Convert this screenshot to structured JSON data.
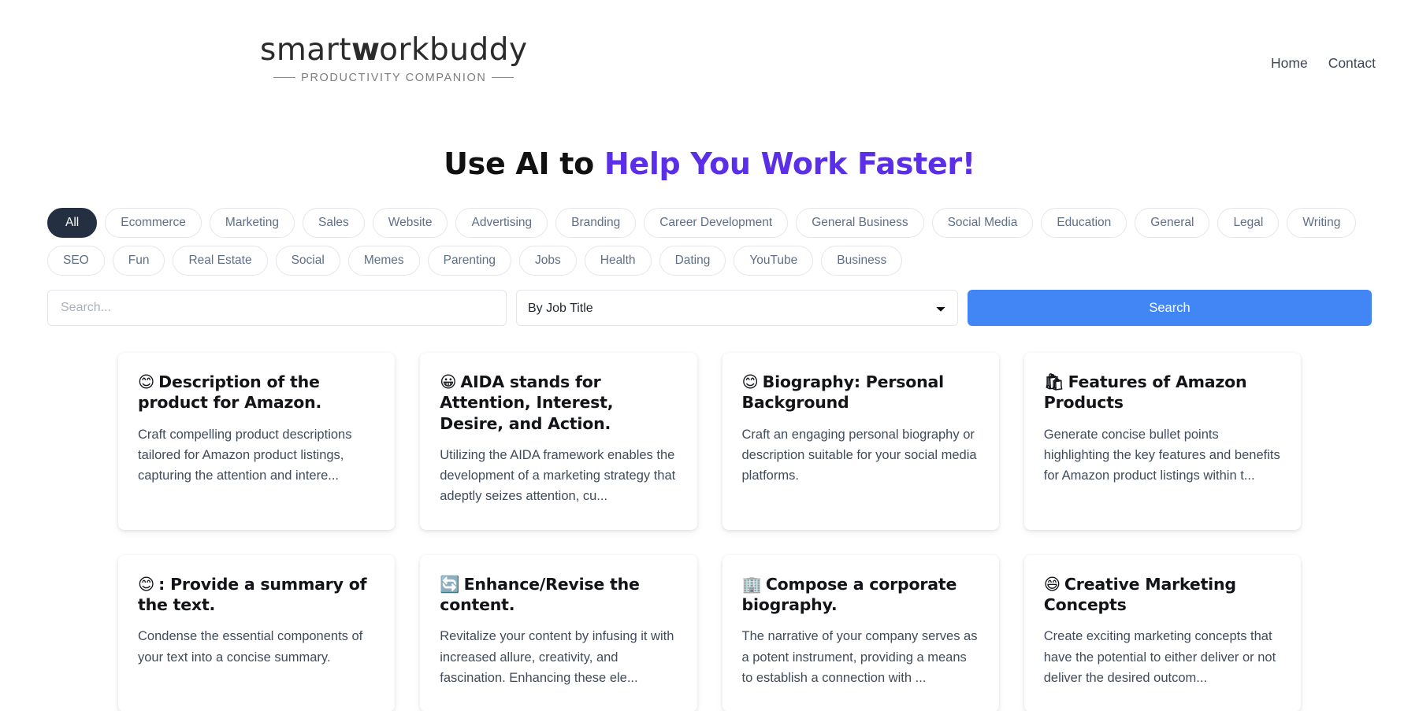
{
  "header": {
    "logo_word_part1": "smart",
    "logo_word_mark": "w",
    "logo_word_part2": "orkbuddy",
    "logo_tagline": "PRODUCTIVITY COMPANION",
    "nav": [
      {
        "label": "Home"
      },
      {
        "label": "Contact"
      }
    ]
  },
  "hero": {
    "title_plain": "Use AI to ",
    "title_accent": "Help You Work Faster!",
    "accent_color": "#5b2ee8"
  },
  "tags": {
    "active": "All",
    "items": [
      {
        "label": "All",
        "active": true
      },
      {
        "label": "Ecommerce",
        "active": false
      },
      {
        "label": "Marketing",
        "active": false
      },
      {
        "label": "Sales",
        "active": false
      },
      {
        "label": "Website",
        "active": false
      },
      {
        "label": "Advertising",
        "active": false
      },
      {
        "label": "Branding",
        "active": false
      },
      {
        "label": "Career Development",
        "active": false
      },
      {
        "label": "General Business",
        "active": false
      },
      {
        "label": "Social Media",
        "active": false
      },
      {
        "label": "Education",
        "active": false
      },
      {
        "label": "General",
        "active": false
      },
      {
        "label": "Legal",
        "active": false
      },
      {
        "label": "Writing",
        "active": false
      },
      {
        "label": "SEO",
        "active": false
      },
      {
        "label": "Fun",
        "active": false
      },
      {
        "label": "Real Estate",
        "active": false
      },
      {
        "label": "Social",
        "active": false
      },
      {
        "label": "Memes",
        "active": false
      },
      {
        "label": "Parenting",
        "active": false
      },
      {
        "label": "Jobs",
        "active": false
      },
      {
        "label": "Health",
        "active": false
      },
      {
        "label": "Dating",
        "active": false
      },
      {
        "label": "YouTube",
        "active": false
      },
      {
        "label": "Business",
        "active": false
      }
    ]
  },
  "search": {
    "placeholder": "Search...",
    "value": "",
    "filter_selected": "By Job Title",
    "filter_options": [
      "By Job Title"
    ],
    "button_label": "Search",
    "button_color": "#4285f4"
  },
  "cards": [
    {
      "emoji": "😊",
      "emoji_name": "smiling-face-icon",
      "title": "Description of the product for Amazon.",
      "description": "Craft compelling product descriptions tailored for Amazon product listings, capturing the attention and intere..."
    },
    {
      "emoji": "😀",
      "emoji_name": "grinning-face-icon",
      "title": "AIDA stands for Attention, Interest, Desire, and Action.",
      "description": "Utilizing the AIDA framework enables the development of a marketing strategy that adeptly seizes attention, cu..."
    },
    {
      "emoji": "😊",
      "emoji_name": "smiling-face-icon",
      "title": "Biography: Personal Background",
      "description": "Craft an engaging personal biography or description suitable for your social media platforms."
    },
    {
      "emoji": "🛍",
      "emoji_name": "shopping-bag-icon",
      "title": "Features of Amazon Products",
      "description": "Generate concise bullet points highlighting the key features and benefits for Amazon product listings within t..."
    },
    {
      "emoji": "😊",
      "emoji_name": "smiling-face-icon",
      "title": ": Provide a summary of the text.",
      "description": "Condense the essential components of your text into a concise summary."
    },
    {
      "emoji": "🔄",
      "emoji_name": "refresh-cycle-icon",
      "title": "Enhance/Revise the content.",
      "description": "Revitalize your content by infusing it with increased allure, creativity, and fascination. Enhancing these ele..."
    },
    {
      "emoji": "🏢",
      "emoji_name": "office-building-icon",
      "title": "Compose a corporate biography.",
      "description": "The narrative of your company serves as a potent instrument, providing a means to establish a connection with ..."
    },
    {
      "emoji": "😄",
      "emoji_name": "laughing-face-icon",
      "title": "Creative Marketing Concepts",
      "description": "Create exciting marketing concepts that have the potential to either deliver or not deliver the desired outcom..."
    }
  ]
}
